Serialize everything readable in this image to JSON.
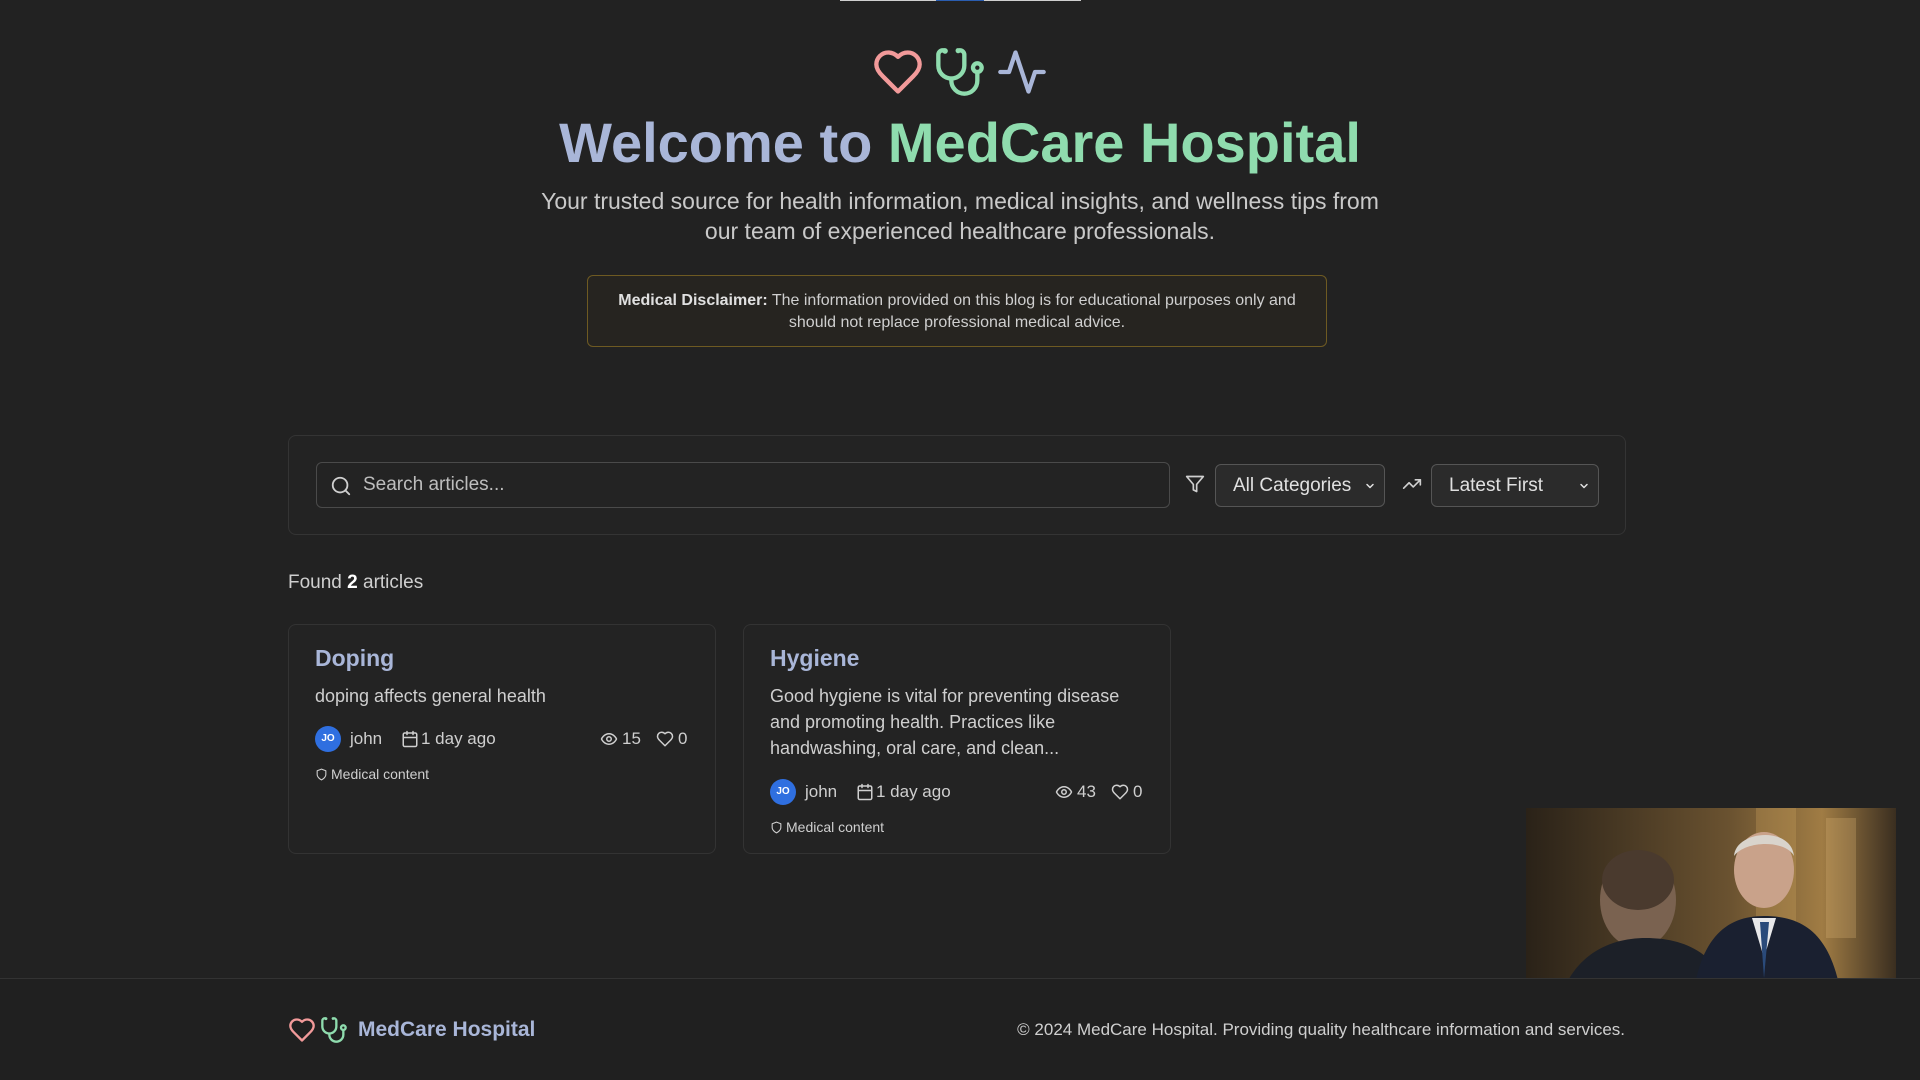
{
  "hero": {
    "title_part1": "Welcome to ",
    "title_part2": "MedCare Hospital",
    "subtitle": "Your trusted source for health information, medical insights, and wellness tips from our team of experienced healthcare professionals.",
    "icons": [
      "heart-icon",
      "stethoscope-icon",
      "activity-icon"
    ]
  },
  "disclaimer": {
    "label": "Medical Disclaimer:",
    "text": " The information provided on this blog is for educational purposes only and should not replace professional medical advice."
  },
  "filters": {
    "search_placeholder": "Search articles...",
    "category_selected": "All Categories",
    "sort_selected": "Latest First"
  },
  "results": {
    "prefix": "Found ",
    "count": "2",
    "suffix": " articles"
  },
  "articles": [
    {
      "title": "Doping",
      "excerpt": "doping affects general health",
      "author_initials": "JO",
      "author": "john",
      "date": "1 day ago",
      "views": "15",
      "likes": "0",
      "tag": "Medical content"
    },
    {
      "title": "Hygiene",
      "excerpt": "Good hygiene is vital for preventing disease and promoting health. Practices like handwashing, oral care, and clean...",
      "author_initials": "JO",
      "author": "john",
      "date": "1 day ago",
      "views": "43",
      "likes": "0",
      "tag": "Medical content"
    }
  ],
  "footer": {
    "brand": "MedCare Hospital",
    "copyright": "© 2024 MedCare Hospital. Providing quality healthcare information and services."
  },
  "colors": {
    "background": "#222222",
    "title_blue": "#a9b6d8",
    "title_green": "#8fdcae",
    "heart_pink": "#f29a9a",
    "avatar_blue": "#2f6fe0",
    "disclaimer_border": "#6e5a22"
  }
}
